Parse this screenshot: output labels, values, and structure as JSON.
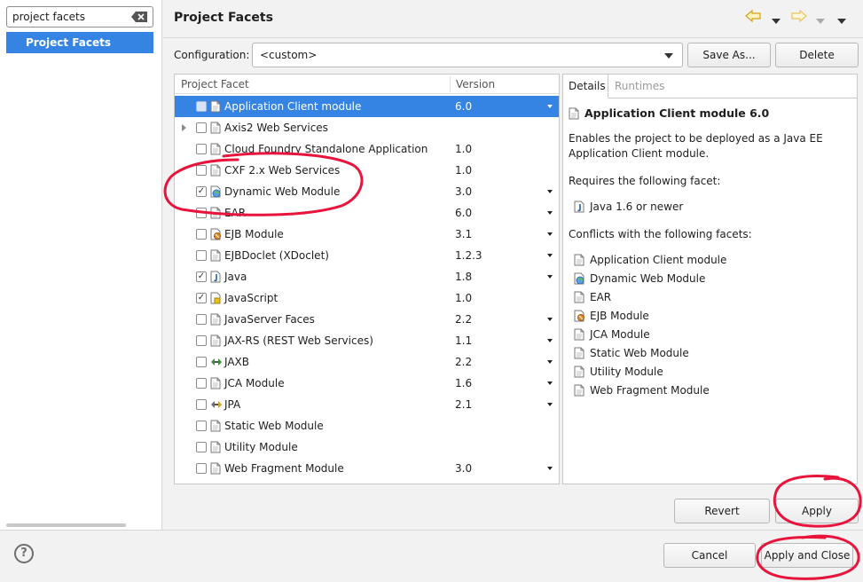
{
  "filter": {
    "value": "project facets"
  },
  "tree": {
    "selected_label": "Project Facets"
  },
  "header": {
    "title": "Project Facets"
  },
  "configuration": {
    "label": "Configuration:",
    "value": "<custom>",
    "save_as_label": "Save As...",
    "delete_label": "Delete"
  },
  "table": {
    "col_facet": "Project Facet",
    "col_version": "Version",
    "rows": [
      {
        "name": "Application Client module",
        "version": "6.0",
        "checked": false,
        "dropdown": true,
        "selected": true,
        "expander": false,
        "icon": "page-icon"
      },
      {
        "name": "Axis2 Web Services",
        "version": "",
        "checked": false,
        "dropdown": false,
        "selected": false,
        "expander": true,
        "icon": "page-icon"
      },
      {
        "name": "Cloud Foundry Standalone Application",
        "version": "1.0",
        "checked": false,
        "dropdown": false,
        "selected": false,
        "expander": false,
        "icon": "page-icon"
      },
      {
        "name": "CXF 2.x Web Services",
        "version": "1.0",
        "checked": false,
        "dropdown": false,
        "selected": false,
        "expander": false,
        "icon": "page-icon"
      },
      {
        "name": "Dynamic Web Module",
        "version": "3.0",
        "checked": true,
        "dropdown": true,
        "selected": false,
        "expander": false,
        "icon": "globe-icon"
      },
      {
        "name": "EAR",
        "version": "6.0",
        "checked": false,
        "dropdown": true,
        "selected": false,
        "expander": false,
        "icon": "page-icon"
      },
      {
        "name": "EJB Module",
        "version": "3.1",
        "checked": false,
        "dropdown": true,
        "selected": false,
        "expander": false,
        "icon": "ejb-icon"
      },
      {
        "name": "EJBDoclet (XDoclet)",
        "version": "1.2.3",
        "checked": false,
        "dropdown": true,
        "selected": false,
        "expander": false,
        "icon": "page-icon"
      },
      {
        "name": "Java",
        "version": "1.8",
        "checked": true,
        "dropdown": true,
        "selected": false,
        "expander": false,
        "icon": "java-icon"
      },
      {
        "name": "JavaScript",
        "version": "1.0",
        "checked": true,
        "dropdown": false,
        "selected": false,
        "expander": false,
        "icon": "js-icon"
      },
      {
        "name": "JavaServer Faces",
        "version": "2.2",
        "checked": false,
        "dropdown": true,
        "selected": false,
        "expander": false,
        "icon": "page-icon"
      },
      {
        "name": "JAX-RS (REST Web Services)",
        "version": "1.1",
        "checked": false,
        "dropdown": true,
        "selected": false,
        "expander": false,
        "icon": "page-icon"
      },
      {
        "name": "JAXB",
        "version": "2.2",
        "checked": false,
        "dropdown": true,
        "selected": false,
        "expander": false,
        "icon": "jaxb-icon"
      },
      {
        "name": "JCA Module",
        "version": "1.6",
        "checked": false,
        "dropdown": true,
        "selected": false,
        "expander": false,
        "icon": "page-icon"
      },
      {
        "name": "JPA",
        "version": "2.1",
        "checked": false,
        "dropdown": true,
        "selected": false,
        "expander": false,
        "icon": "jpa-icon"
      },
      {
        "name": "Static Web Module",
        "version": "",
        "checked": false,
        "dropdown": false,
        "selected": false,
        "expander": false,
        "icon": "page-icon"
      },
      {
        "name": "Utility Module",
        "version": "",
        "checked": false,
        "dropdown": false,
        "selected": false,
        "expander": false,
        "icon": "page-icon"
      },
      {
        "name": "Web Fragment Module",
        "version": "3.0",
        "checked": false,
        "dropdown": true,
        "selected": false,
        "expander": false,
        "icon": "page-icon"
      }
    ]
  },
  "details": {
    "tab_details": "Details",
    "tab_runtimes": "Runtimes",
    "title": "Application Client module 6.0",
    "description": "Enables the project to be deployed as a Java EE Application Client module.",
    "requires_label": "Requires the following facet:",
    "requires": [
      {
        "name": "Java 1.6 or newer",
        "icon": "java-icon"
      }
    ],
    "conflicts_label": "Conflicts with the following facets:",
    "conflicts": [
      {
        "name": "Application Client module",
        "icon": "page-icon"
      },
      {
        "name": "Dynamic Web Module",
        "icon": "globe-icon"
      },
      {
        "name": "EAR",
        "icon": "page-icon"
      },
      {
        "name": "EJB Module",
        "icon": "ejb-icon"
      },
      {
        "name": "JCA Module",
        "icon": "page-icon"
      },
      {
        "name": "Static Web Module",
        "icon": "page-icon"
      },
      {
        "name": "Utility Module",
        "icon": "page-icon"
      },
      {
        "name": "Web Fragment Module",
        "icon": "page-icon"
      }
    ]
  },
  "buttons": {
    "revert": "Revert",
    "apply": "Apply",
    "cancel": "Cancel",
    "apply_close": "Apply and Close"
  },
  "help": {
    "glyph": "?"
  },
  "colors": {
    "selection": "#3584e4",
    "annotation": "#e8143c"
  }
}
